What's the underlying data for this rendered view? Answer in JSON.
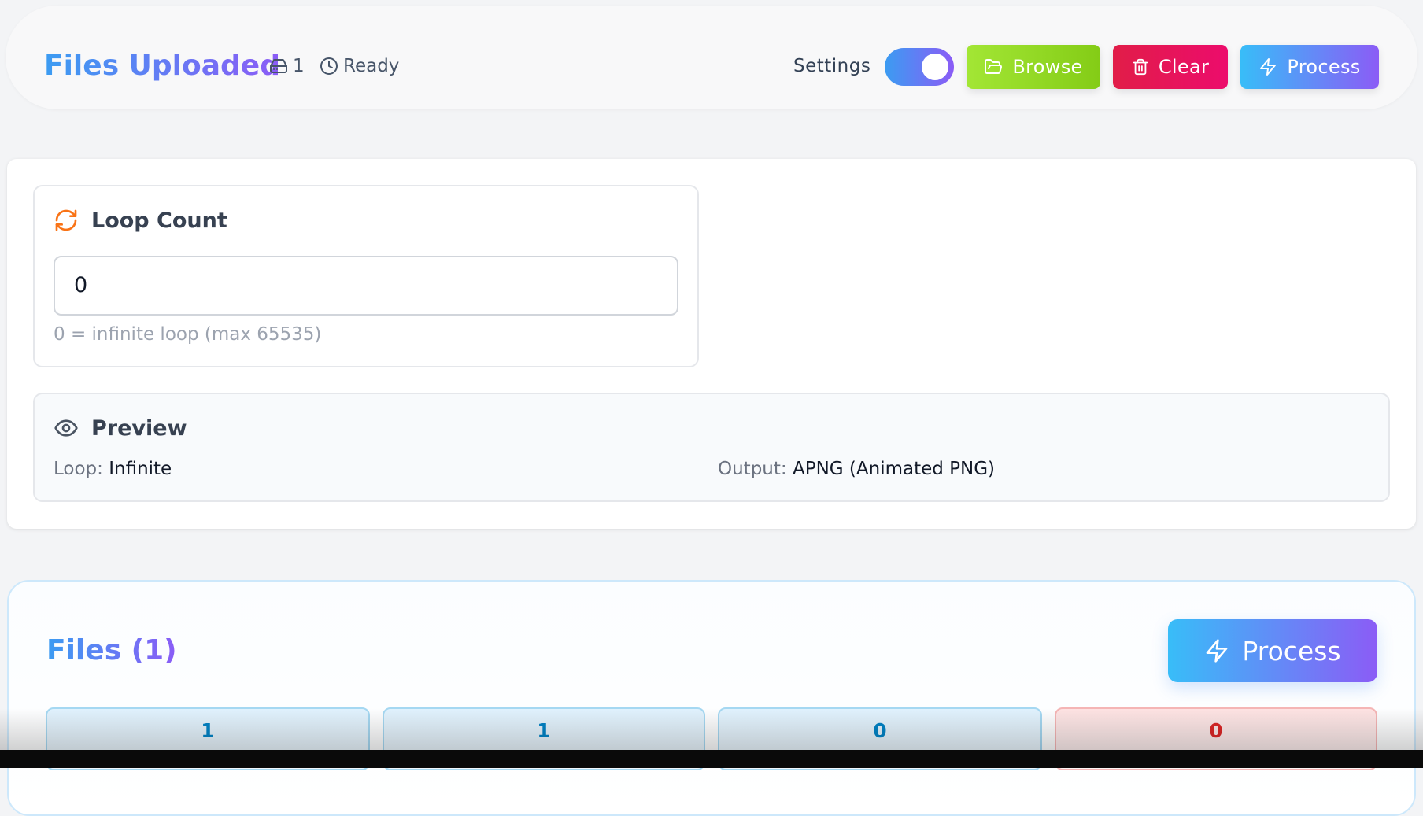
{
  "header": {
    "title": "Files Uploaded",
    "file_count": "1",
    "status": "Ready",
    "settings_label": "Settings",
    "settings_toggle_on": true,
    "buttons": {
      "browse": "Browse",
      "clear": "Clear",
      "process": "Process"
    }
  },
  "settings": {
    "loop_count": {
      "title": "Loop Count",
      "value": "0",
      "hint": "0 = infinite loop (max 65535)"
    },
    "preview": {
      "title": "Preview",
      "loop_label": "Loop:",
      "loop_value": "Infinite",
      "output_label": "Output:",
      "output_value": "APNG (Animated PNG)"
    }
  },
  "files": {
    "title": "Files (1)",
    "process_label": "Process",
    "stats": [
      "1",
      "1",
      "0",
      "0"
    ]
  },
  "colors": {
    "accent_gradient_start": "#3b9cf2",
    "accent_gradient_end": "#8b5cf6",
    "browse": "#a3e635",
    "clear": "#e11d48",
    "loop_icon": "#f97316"
  },
  "icons": {
    "file_count": "hard-drive-icon",
    "status": "clock-icon",
    "browse": "folder-open-icon",
    "clear": "trash-icon",
    "process": "zap-icon",
    "loop": "refresh-icon",
    "preview": "eye-icon"
  }
}
